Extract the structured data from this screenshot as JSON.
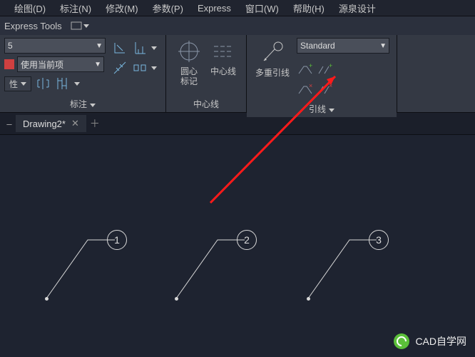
{
  "menu": {
    "draw": "绘图(D)",
    "dim": "标注(N)",
    "modify": "修改(M)",
    "param": "参数(P)",
    "express": "Express",
    "window": "窗口(W)",
    "help": "帮助(H)",
    "yuanquan": "源泉设计"
  },
  "toolsbar": {
    "express": "Express Tools"
  },
  "ribbon": {
    "dimStyle": {
      "value": "5",
      "layerValue": "使用当前项",
      "propLabel": "性",
      "panelTitle": "标注"
    },
    "center": {
      "btn1": "圆心\n标记",
      "btn2": "中心线",
      "title": "中心线"
    },
    "leader": {
      "btn": "多重引线",
      "style": "Standard",
      "title": "引线"
    }
  },
  "tabs": {
    "name": "Drawing2*"
  },
  "leaders": {
    "l1": "1",
    "l2": "2",
    "l3": "3"
  },
  "watermark": {
    "text": "CAD自学网"
  }
}
